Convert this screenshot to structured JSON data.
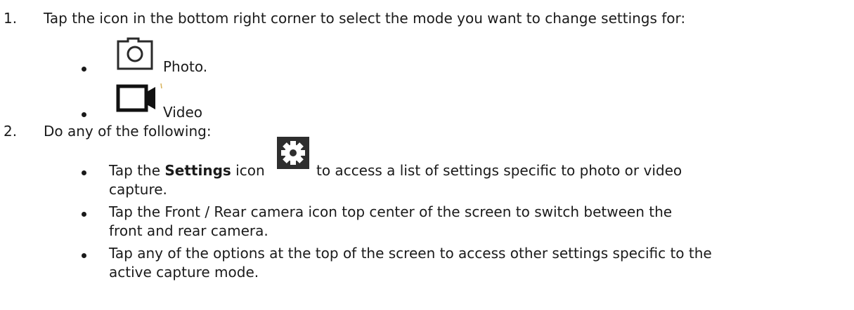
{
  "steps": [
    {
      "number": "1.",
      "text": "Tap the icon in the bottom right corner to select the mode you want to change settings for:",
      "modes": [
        {
          "icon": "camera-icon",
          "label": "Photo."
        },
        {
          "icon": "video-camera-icon",
          "label": "Video"
        }
      ]
    },
    {
      "number": "2.",
      "text": "Do any of the following:",
      "bullets": [
        {
          "prefix": "Tap the ",
          "bold": "Settings",
          "after_bold": " icon",
          "icon": "gear-icon",
          "suffix_line1": "to access a list of settings specific to photo or video",
          "line2": "capture."
        },
        {
          "line1": "Tap the Front / Rear camera icon top center of the screen to switch between the",
          "line2": "front and rear camera."
        },
        {
          "line1": "Tap any of the options at the top of the screen to access other settings specific to the",
          "line2": "active capture mode."
        }
      ]
    }
  ]
}
